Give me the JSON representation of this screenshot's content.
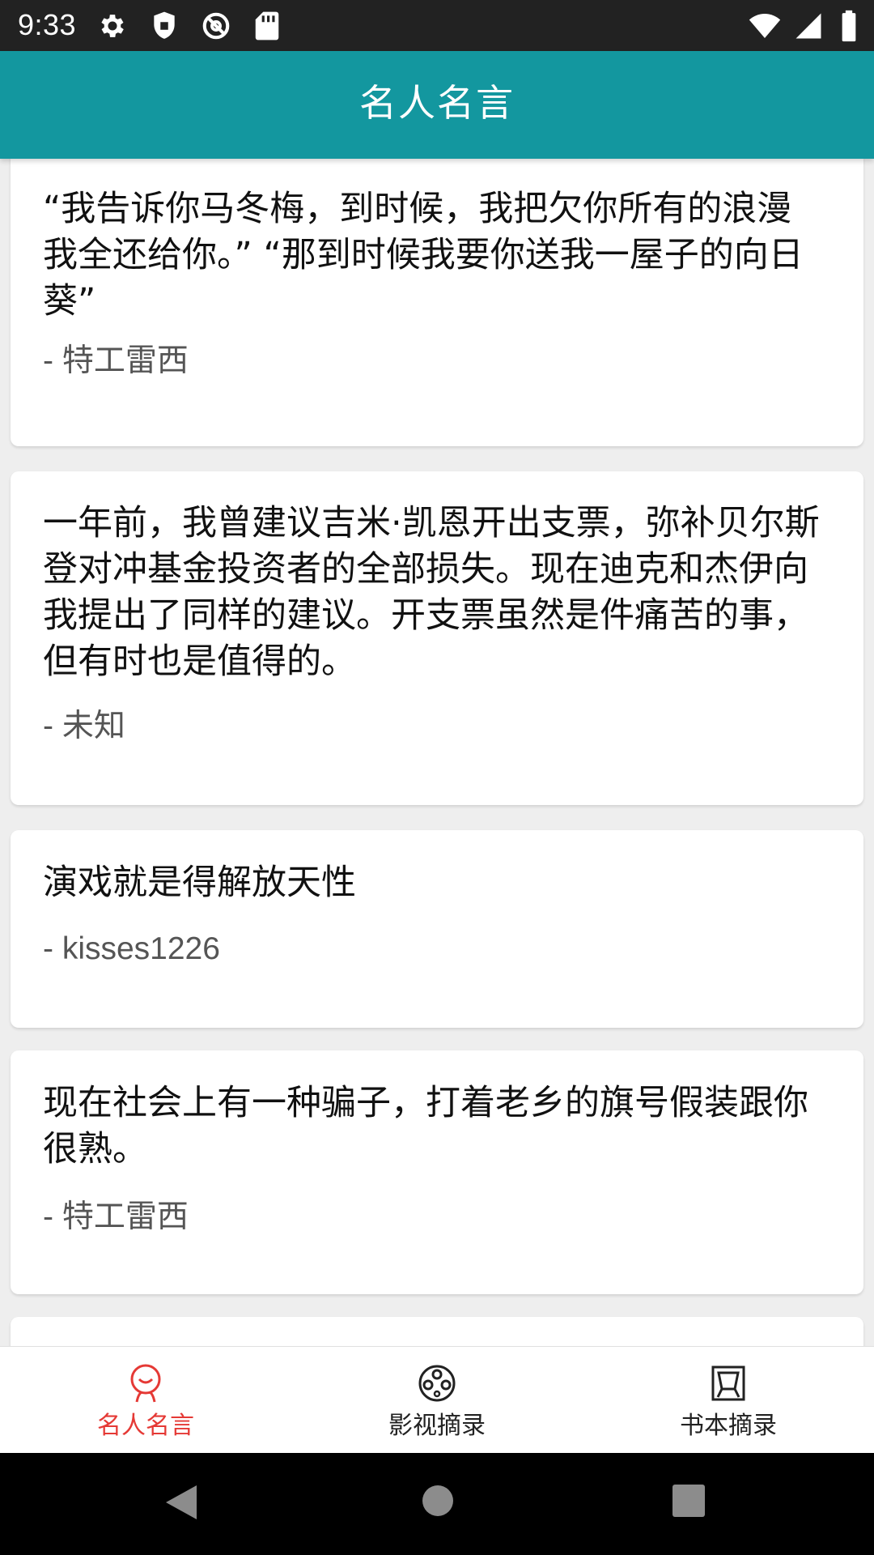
{
  "status_bar": {
    "time": "9:33",
    "left_icons": [
      "settings-icon",
      "shield-icon",
      "sync-disabled-icon",
      "sd-card-icon"
    ],
    "right_icons": [
      "wifi-icon",
      "cell-signal-icon",
      "battery-icon"
    ]
  },
  "app_bar": {
    "title": "名人名言",
    "color": "#13979f"
  },
  "quotes": [
    {
      "text": "“我告诉你马冬梅，到时候，我把欠你所有的浪漫我全还给你。” “那到时候我要你送我一屋子的向日葵”",
      "author": "- 特工雷西"
    },
    {
      "text": "一年前，我曾建议吉米·凯恩开出支票，弥补贝尔斯登对冲基金投资者的全部损失。现在迪克和杰伊向我提出了同样的建议。开支票虽然是件痛苦的事，但有时也是值得的。",
      "author": "- 未知"
    },
    {
      "text": "演戏就是得解放天性",
      "author": "- kisses1226"
    },
    {
      "text": "现在社会上有一种骗子，打着老乡的旗号假装跟你很熟。",
      "author": "- 特工雷西"
    }
  ],
  "bottom_nav": {
    "items": [
      {
        "label": "名人名言",
        "icon": "person-icon",
        "active": true
      },
      {
        "label": "影视摘录",
        "icon": "film-reel-icon",
        "active": false
      },
      {
        "label": "书本摘录",
        "icon": "book-icon",
        "active": false
      }
    ],
    "active_color": "#e53935"
  },
  "system_nav": {
    "buttons": [
      "back-icon",
      "home-icon",
      "recents-icon"
    ]
  }
}
